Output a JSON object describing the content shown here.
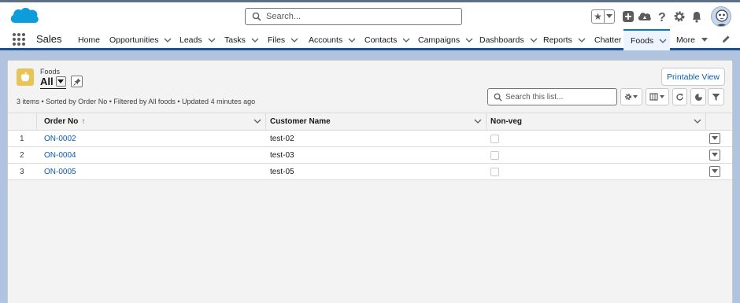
{
  "header": {
    "search_placeholder": "Search...",
    "icons": [
      "salesforce-cloud-logo",
      "favorites-star-icon",
      "add-icon",
      "trailhead-icon",
      "help-icon",
      "setup-gear-icon",
      "notifications-bell-icon",
      "user-avatar"
    ]
  },
  "nav": {
    "app_name": "Sales",
    "items": [
      {
        "label": "Home",
        "dropdown": false
      },
      {
        "label": "Opportunities",
        "dropdown": true
      },
      {
        "label": "Leads",
        "dropdown": true
      },
      {
        "label": "Tasks",
        "dropdown": true
      },
      {
        "label": "Files",
        "dropdown": true
      },
      {
        "label": "Accounts",
        "dropdown": true
      },
      {
        "label": "Contacts",
        "dropdown": true
      },
      {
        "label": "Campaigns",
        "dropdown": true
      },
      {
        "label": "Dashboards",
        "dropdown": true
      },
      {
        "label": "Reports",
        "dropdown": true
      },
      {
        "label": "Chatter",
        "dropdown": false
      },
      {
        "label": "Foods",
        "dropdown": true,
        "active": true
      },
      {
        "label": "More",
        "dropdown": true
      }
    ]
  },
  "list_view": {
    "object_label": "Foods",
    "view_name": "All",
    "meta": "3 items • Sorted by Order No • Filtered by All foods • Updated 4 minutes ago",
    "printable_button": "Printable View",
    "search_placeholder": "Search this list..."
  },
  "table": {
    "columns": [
      "Order No",
      "Customer Name",
      "Non-veg"
    ],
    "sort_indicator": "↑",
    "rows": [
      {
        "num": "1",
        "order_no": "ON-0002",
        "customer": "test-02",
        "non_veg": false
      },
      {
        "num": "2",
        "order_no": "ON-0004",
        "customer": "test-03",
        "non_veg": false
      },
      {
        "num": "3",
        "order_no": "ON-0005",
        "customer": "test-05",
        "non_veg": false
      }
    ]
  },
  "colors": {
    "brand_blue": "#0176d3",
    "link_blue": "#0b5cab",
    "nav_underline": "#1b5297",
    "background": "#b0c4df",
    "object_icon": "#e6c457"
  }
}
